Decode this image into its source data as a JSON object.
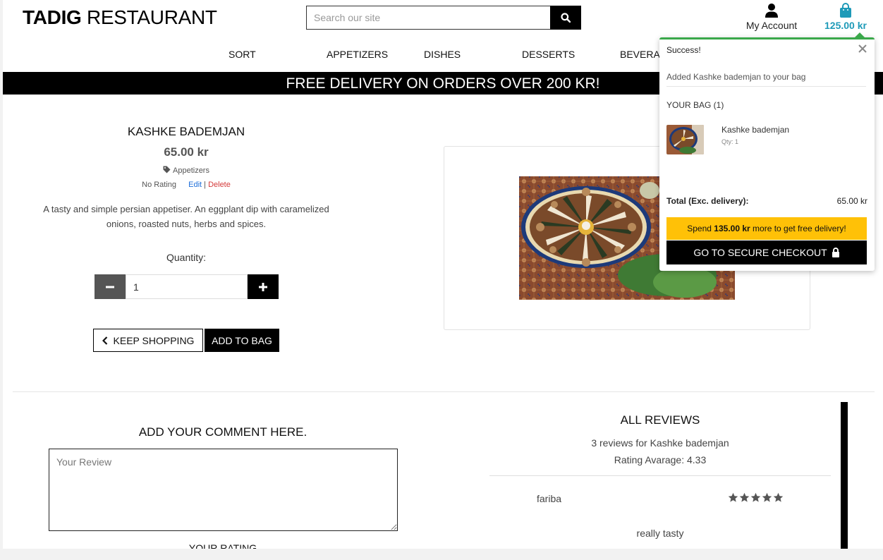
{
  "header": {
    "brand_bold": "TADIG",
    "brand_rest": " RESTAURANT",
    "search_placeholder": "Search our site",
    "account_label": "My Account",
    "bag_total": "125.00 kr"
  },
  "nav": {
    "items": [
      "Sort",
      "Appetizers",
      "Dishes",
      "Desserts",
      "Beverag"
    ]
  },
  "banner": "FREE DELIVERY ON ORDERS OVER 200 KR!",
  "product": {
    "name": "Kashke bademjan",
    "price": "65.00 kr",
    "category": "Appetizers",
    "rating": "No Rating",
    "edit_label": "Edit",
    "separator": "|",
    "delete_label": "Delete",
    "description": "A tasty and simple persian appetiser. An eggplant dip with caramelized onions, roasted nuts, herbs and spices.",
    "quantity_label": "Quantity:",
    "quantity_value": "1",
    "keep_shopping_label": "Keep Shopping",
    "add_to_bag_label": "Add to bag"
  },
  "comment": {
    "title": "Add your comment here.",
    "placeholder": "Your Review",
    "rating_title": "Your Rating"
  },
  "reviews": {
    "title": "All Reviews",
    "count_text": "3 reviews for Kashke bademjan",
    "average_text": "Rating Avarage: 4.33",
    "items": [
      {
        "author": "fariba",
        "stars": 5,
        "text": "really tasty"
      }
    ]
  },
  "toast": {
    "heading": "Success!",
    "message": "Added Kashke bademjan to your bag",
    "bag_heading": "Your Bag (1)",
    "item_name": "Kashke bademjan",
    "item_qty": "Qty: 1",
    "total_label": "Total (Exc. delivery):",
    "total_value": "65.00 kr",
    "promo_prefix": "Spend ",
    "promo_amount": "135.00 kr",
    "promo_suffix": " more to get free delivery!",
    "checkout_label": "Go to secure checkout"
  },
  "colors": {
    "accent_bag": "#1e9ab8",
    "success": "#3aa84a",
    "promo": "#ffc107",
    "delete": "#d43a3a",
    "edit": "#1e6fd9"
  },
  "icons": [
    "search-icon",
    "user-icon",
    "shopping-bag-icon",
    "tag-icon",
    "minus-icon",
    "plus-icon",
    "chevron-left-icon",
    "close-icon",
    "lock-icon",
    "star-icon"
  ]
}
